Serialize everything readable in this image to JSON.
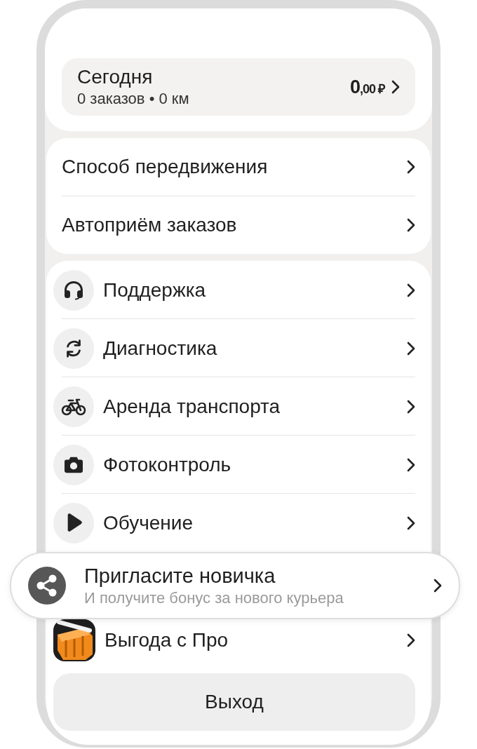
{
  "today": {
    "title": "Сегодня",
    "subtitle": "0 заказов • 0 км",
    "amount": "0",
    "amount_fraction": ",00 ₽"
  },
  "settings": [
    {
      "label": "Способ передвижения"
    },
    {
      "label": "Автоприём заказов"
    }
  ],
  "menu": [
    {
      "kind": "row",
      "label": "Поддержка"
    },
    {
      "kind": "row",
      "label": "Диагностика"
    },
    {
      "kind": "row",
      "label": "Аренда транспорта"
    },
    {
      "kind": "row",
      "label": "Фотоконтроль"
    },
    {
      "kind": "row",
      "label": "Обучение"
    },
    {
      "kind": "promo",
      "title": "Пригласите новичка",
      "subtitle": "И получите бонус за нового курьера"
    },
    {
      "kind": "row",
      "label": "Выгода с Про"
    }
  ],
  "exit_button": "Выход"
}
